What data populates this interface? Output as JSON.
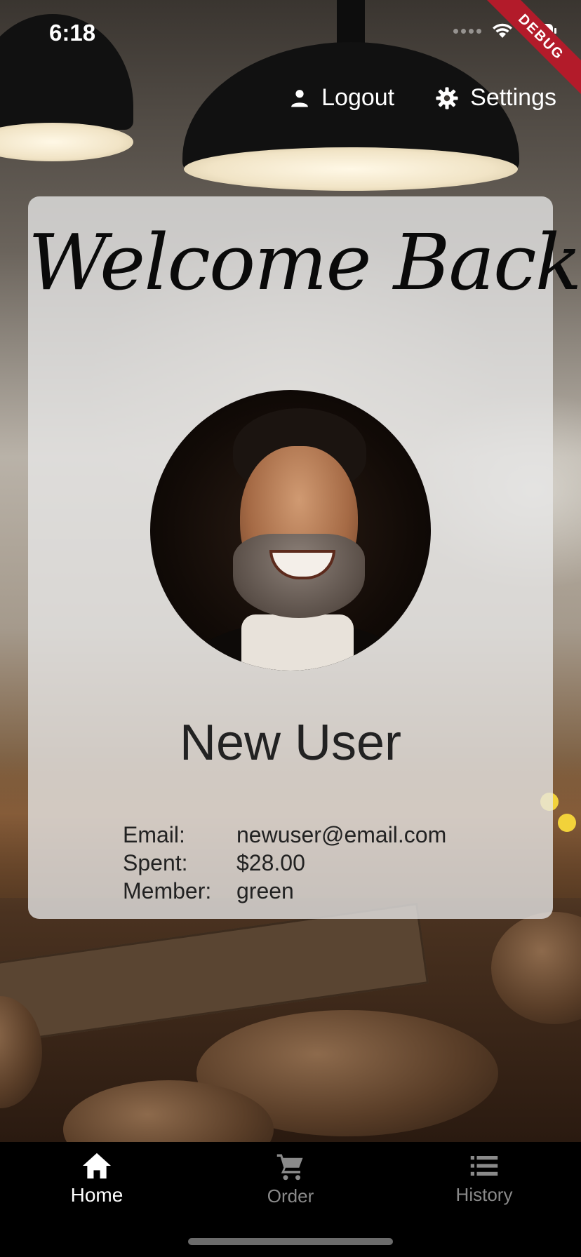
{
  "status_bar": {
    "time": "6:18"
  },
  "debug_banner": "DEBUG",
  "top_actions": {
    "logout": {
      "label": "Logout",
      "icon": "person-icon"
    },
    "settings": {
      "label": "Settings",
      "icon": "gear-icon"
    }
  },
  "card": {
    "welcome": "Welcome Back!",
    "user_name": "New User",
    "info": [
      {
        "label": "Email:",
        "value": "newuser@email.com"
      },
      {
        "label": "Spent:",
        "value": "$28.00"
      },
      {
        "label": "Member:",
        "value": "green"
      }
    ]
  },
  "bottom_nav": {
    "items": [
      {
        "label": "Home",
        "icon": "home-icon",
        "active": true
      },
      {
        "label": "Order",
        "icon": "cart-icon",
        "active": false
      },
      {
        "label": "History",
        "icon": "list-icon",
        "active": false
      }
    ]
  },
  "colors": {
    "card_background": "#e8e8e8",
    "nav_background": "#000000",
    "nav_active": "#ffffff",
    "nav_inactive": "#8a8a8a",
    "debug_ribbon": "#b31b2a"
  }
}
